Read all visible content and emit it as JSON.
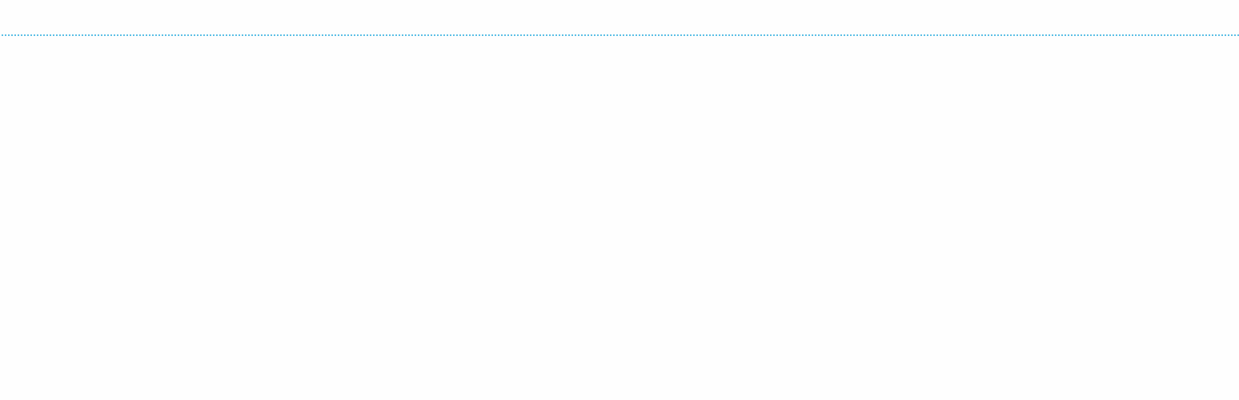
{
  "page": {
    "background_color": "#fefefe",
    "divider": {
      "style": "dotted",
      "color": "#5bbfe6"
    }
  }
}
